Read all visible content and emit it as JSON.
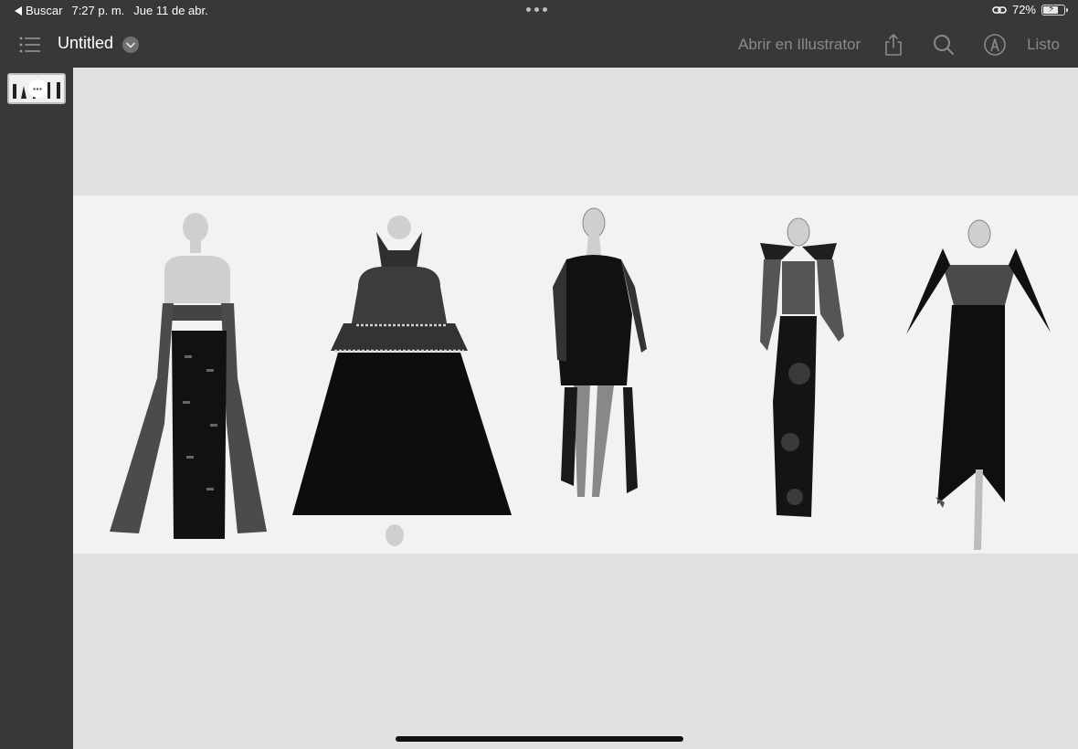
{
  "status": {
    "back_label": "Buscar",
    "time": "7:27 p. m.",
    "date": "Jue 11 de abr.",
    "battery": "72%",
    "battery_level": 0.72
  },
  "toolbar": {
    "doc_title": "Untitled",
    "open_in_app": "Abrir en Illustrator",
    "done": "Listo",
    "icons": [
      "list-icon",
      "chevron-down-icon",
      "share-icon",
      "search-icon",
      "markup-icon"
    ]
  },
  "sidebar": {
    "pages": [
      {
        "thumbnail": "page-1-thumbnail",
        "selected": true
      }
    ]
  },
  "canvas": {
    "artboard": "fashion-illustration-artboard",
    "figures": [
      "figure-1",
      "figure-2",
      "figure-3",
      "figure-4",
      "figure-5"
    ]
  }
}
